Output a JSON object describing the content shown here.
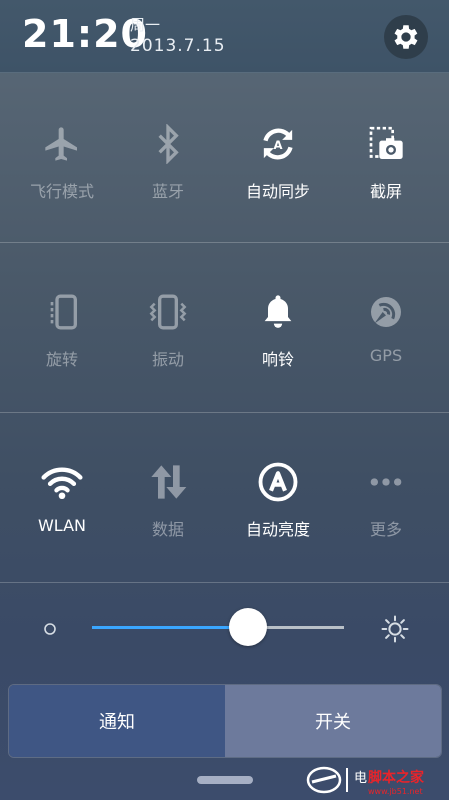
{
  "status": {
    "time": "21:20",
    "weekday": "周一",
    "date": "2013.7.15"
  },
  "toggles": [
    {
      "label": "飞行模式",
      "icon": "airplane-icon",
      "state": "off"
    },
    {
      "label": "蓝牙",
      "icon": "bluetooth-icon",
      "state": "off"
    },
    {
      "label": "自动同步",
      "icon": "sync-icon",
      "state": "on"
    },
    {
      "label": "截屏",
      "icon": "screenshot-icon",
      "state": "on"
    },
    {
      "label": "旋转",
      "icon": "rotate-icon",
      "state": "off"
    },
    {
      "label": "振动",
      "icon": "vibrate-icon",
      "state": "off"
    },
    {
      "label": "响铃",
      "icon": "bell-icon",
      "state": "on"
    },
    {
      "label": "GPS",
      "icon": "gps-icon",
      "state": "off"
    },
    {
      "label": "WLAN",
      "icon": "wifi-icon",
      "state": "on"
    },
    {
      "label": "数据",
      "icon": "data-icon",
      "state": "off"
    },
    {
      "label": "自动亮度",
      "icon": "auto-brightness-icon",
      "state": "on"
    },
    {
      "label": "更多",
      "icon": "more-icon",
      "state": "off"
    }
  ],
  "brightness": {
    "level": 0.62
  },
  "tabs": {
    "notify": "通知",
    "switches": "开关",
    "active": "notify"
  },
  "watermark": {
    "text": "电脑百事网 脚本之家",
    "url": "www.jb51.net"
  },
  "colors": {
    "accent": "#3aa6ff",
    "active_tab": "#3f5684",
    "inactive_tab": "#6d7a9c"
  }
}
